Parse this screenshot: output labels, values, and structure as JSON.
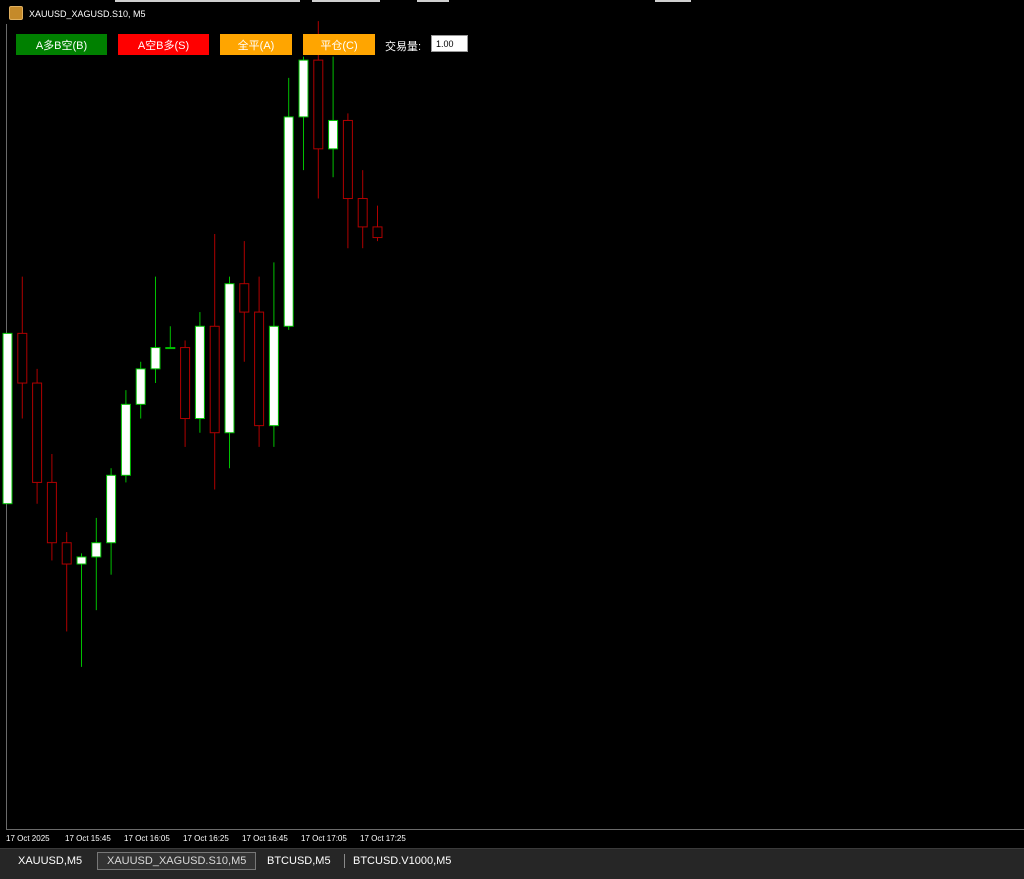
{
  "window": {
    "title": "XAUUSD_XAGUSD.S10, M5"
  },
  "toolbar": {
    "buttons": [
      {
        "label": "A多B空(B)",
        "color": "#008000"
      },
      {
        "label": "A空B多(S)",
        "color": "#ff0000"
      },
      {
        "label": "全平(A)",
        "color": "#ffa500"
      },
      {
        "label": "平仓(C)",
        "color": "#ffa500"
      }
    ],
    "lot_label": "交易量:",
    "lot_value": "1.00"
  },
  "colors": {
    "bull_wick": "#00c000",
    "bear": "#b00000",
    "bull_body": "#ffffff",
    "background": "#000000"
  },
  "chart_data": {
    "type": "candlestick",
    "x_labels": [
      "17 Oct 2025",
      "17 Oct 15:45",
      "17 Oct 16:05",
      "17 Oct 16:25",
      "17 Oct 16:45",
      "17 Oct 17:05",
      "17 Oct 17:25"
    ],
    "ylim": [
      0,
      100
    ],
    "candles": [
      {
        "o": 34,
        "h": 58,
        "l": 34,
        "c": 58
      },
      {
        "o": 58,
        "h": 66,
        "l": 46,
        "c": 51
      },
      {
        "o": 51,
        "h": 53,
        "l": 34,
        "c": 37
      },
      {
        "o": 37,
        "h": 41,
        "l": 26,
        "c": 28.5
      },
      {
        "o": 28.5,
        "h": 30,
        "l": 16,
        "c": 25.5
      },
      {
        "o": 25.5,
        "h": 27,
        "l": 11,
        "c": 26.5
      },
      {
        "o": 26.5,
        "h": 32,
        "l": 19,
        "c": 28.5
      },
      {
        "o": 28.5,
        "h": 39,
        "l": 24,
        "c": 38
      },
      {
        "o": 38,
        "h": 50,
        "l": 37,
        "c": 48
      },
      {
        "o": 48,
        "h": 54,
        "l": 46,
        "c": 53
      },
      {
        "o": 53,
        "h": 66,
        "l": 51,
        "c": 56
      },
      {
        "o": 56,
        "h": 59,
        "l": 56,
        "c": 56
      },
      {
        "o": 56,
        "h": 57,
        "l": 42,
        "c": 46
      },
      {
        "o": 46,
        "h": 61,
        "l": 44,
        "c": 59
      },
      {
        "o": 59,
        "h": 72,
        "l": 36,
        "c": 44
      },
      {
        "o": 44,
        "h": 66,
        "l": 39,
        "c": 65
      },
      {
        "o": 65,
        "h": 71,
        "l": 54,
        "c": 61
      },
      {
        "o": 61,
        "h": 66,
        "l": 42,
        "c": 45
      },
      {
        "o": 45,
        "h": 68,
        "l": 42,
        "c": 59
      },
      {
        "o": 59,
        "h": 94,
        "l": 58.5,
        "c": 88.5
      },
      {
        "o": 88.5,
        "h": 97,
        "l": 81,
        "c": 96.5
      },
      {
        "o": 96.5,
        "h": 102,
        "l": 77,
        "c": 84
      },
      {
        "o": 84,
        "h": 97,
        "l": 80,
        "c": 88
      },
      {
        "o": 88,
        "h": 89,
        "l": 70,
        "c": 77
      },
      {
        "o": 77,
        "h": 81,
        "l": 70,
        "c": 73
      },
      {
        "o": 73,
        "h": 76,
        "l": 71,
        "c": 71.5
      }
    ]
  },
  "tabs": [
    {
      "label": "XAUUSD,M5",
      "active": false
    },
    {
      "label": "XAUUSD_XAGUSD.S10,M5",
      "active": true
    },
    {
      "label": "BTCUSD,M5",
      "active": false
    },
    {
      "label": "BTCUSD.V1000,M5",
      "active": false
    }
  ]
}
